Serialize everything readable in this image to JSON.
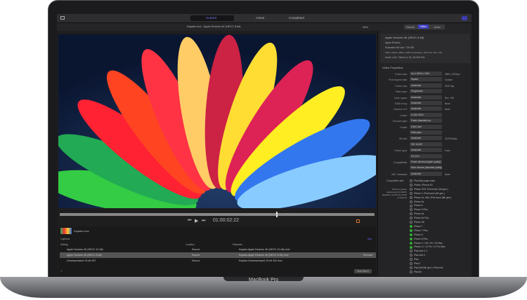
{
  "toolbar": {
    "tabs": [
      "Current",
      "Active",
      "Completed"
    ],
    "active_tab": "Current"
  },
  "viewer": {
    "title": "Kayaks.mov - Apple Devices 4K (HEVC 8-bit)",
    "zoom": "34%",
    "timecode": "01:00:02:22"
  },
  "inspector": {
    "tabs": [
      "General",
      "Video",
      "Audio"
    ],
    "active_tab": "Video",
    "summary": {
      "name": "Apple Devices 4K (HEVC 8-bit)",
      "category": "Apple Devices",
      "size": "Estimated file size: 726 MB",
      "video": "Video: HEVC, 3840 x 2026, Progressive, 29.97 fps, Rec. 709",
      "audio": "Audio: AAC, Stereo (L R), 48,000 kHz"
    },
    "section": "Video Properties",
    "rows": [
      {
        "label": "Frame size:",
        "value": "Up to 3840 x 2160",
        "extra": "3840 x 2026 px"
      },
      {
        "label": "Pixel aspect ratio:",
        "value": "Square",
        "extra": "Custom"
      },
      {
        "label": "Frame rate:",
        "value": "Automatic",
        "extra": "29.97 fps"
      },
      {
        "label": "Field order:",
        "value": "Progressive",
        "extra": ""
      },
      {
        "label": "Color space:",
        "value": "Automatic",
        "extra": "Rec. 709"
      },
      {
        "label": "RAW to log:",
        "value": "Automatic",
        "extra": "None"
      },
      {
        "label": "Camera LUT:",
        "value": "Automatic",
        "extra": "None"
      },
      {
        "label": "Codec:",
        "value": "H.264   HEVC",
        "extra": ""
      },
      {
        "label": "Encoder type:",
        "value": "Faster (standard qu...",
        "extra": ""
      },
      {
        "label": "Profile:",
        "value": "8-Bit Color",
        "extra": ""
      },
      {
        "label": "",
        "value": "Multi-pass",
        "extra": ""
      },
      {
        "label": "Bit rate:",
        "value": "Automatic",
        "extra": "16,976 kbps"
      },
      {
        "label": "",
        "value": "200        16,000",
        "extra": ""
      },
      {
        "label": "Frame sync:",
        "value": "Automatic",
        "extra": "0 sec"
      },
      {
        "label": "",
        "value": "0.5        10.0",
        "extra": ""
      },
      {
        "label": "Compatibility:",
        "value": "Fewer devices (higher quality)",
        "extra": ""
      },
      {
        "label": "",
        "value": "More devices (standard quality)",
        "extra": ""
      },
      {
        "label": "360° metadata:",
        "value": "Automatic",
        "extra": "None"
      }
    ],
    "compat_label": "Compatible with:",
    "min_req": "Minimum system requirements for HEVC playback: macOS 10.13 iOS 11 tvOS 11",
    "devices": [
      {
        "name": "iPod (fits) plays video",
        "ok": false
      },
      {
        "name": "iPhone, iPhone 3G",
        "ok": false
      },
      {
        "name": "iPhone 3GS, iPod touch (3rd gen.)",
        "ok": false
      },
      {
        "name": "iPhone 4, iPod touch (4th gen.)",
        "ok": false
      },
      {
        "name": "iPhone 4s, 5/5c, iPod touch (5th gen.)",
        "ok": false
      },
      {
        "name": "iPhone 5s",
        "ok": false
      },
      {
        "name": "iPhone 6",
        "ok": false
      },
      {
        "name": "iPhone 6 Plus",
        "ok": false
      },
      {
        "name": "iPhone 6s",
        "ok": false
      },
      {
        "name": "iPhone 6s Plus",
        "ok": false
      },
      {
        "name": "iPhone SE",
        "ok": false
      },
      {
        "name": "iPhone 7",
        "ok": true
      },
      {
        "name": "iPhone 7 Plus",
        "ok": true
      },
      {
        "name": "iPhone 8",
        "ok": true
      },
      {
        "name": "iPhone 8 Plus",
        "ok": true
      },
      {
        "name": "iPhone X / XR / XS / XS Max",
        "ok": true
      },
      {
        "name": "iPhone 11 / 11 Pro / 11 Pro Max",
        "ok": true
      },
      {
        "name": "iPad mini 2, 3",
        "ok": false
      },
      {
        "name": "iPad mini 4",
        "ok": false
      },
      {
        "name": "iPad",
        "ok": false
      },
      {
        "name": "iPad 2",
        "ok": false
      },
      {
        "name": "iPad (3rd/4th gen.), iPad mini",
        "ok": false
      },
      {
        "name": "iPad Air",
        "ok": false
      }
    ]
  },
  "batch": {
    "file": "Kayaks.mov",
    "captions": "Captions",
    "add": "Add",
    "headers": [
      "Setting",
      "Location",
      "Filename"
    ],
    "rows": [
      {
        "setting": "Apple Devices 4K (HEVC 10-bit)",
        "location": "Source",
        "filename": "Kayaks-Apple Devices 4K (HEVC 10-bit).m4v"
      },
      {
        "setting": "Apple Devices 4K (HEVC 8-bit)",
        "location": "Source",
        "filename": "Kayaks-Apple Devices 4K (HEVC 8-bit).m4v",
        "action": "Remove"
      },
      {
        "setting": "Uncompressed 10-bit 422",
        "location": "Source",
        "filename": "Kayaks-Uncompressed 10-bit 422.mov"
      }
    ],
    "start": "Start Batch"
  },
  "laptop": {
    "brand": "MacBook Pro"
  }
}
